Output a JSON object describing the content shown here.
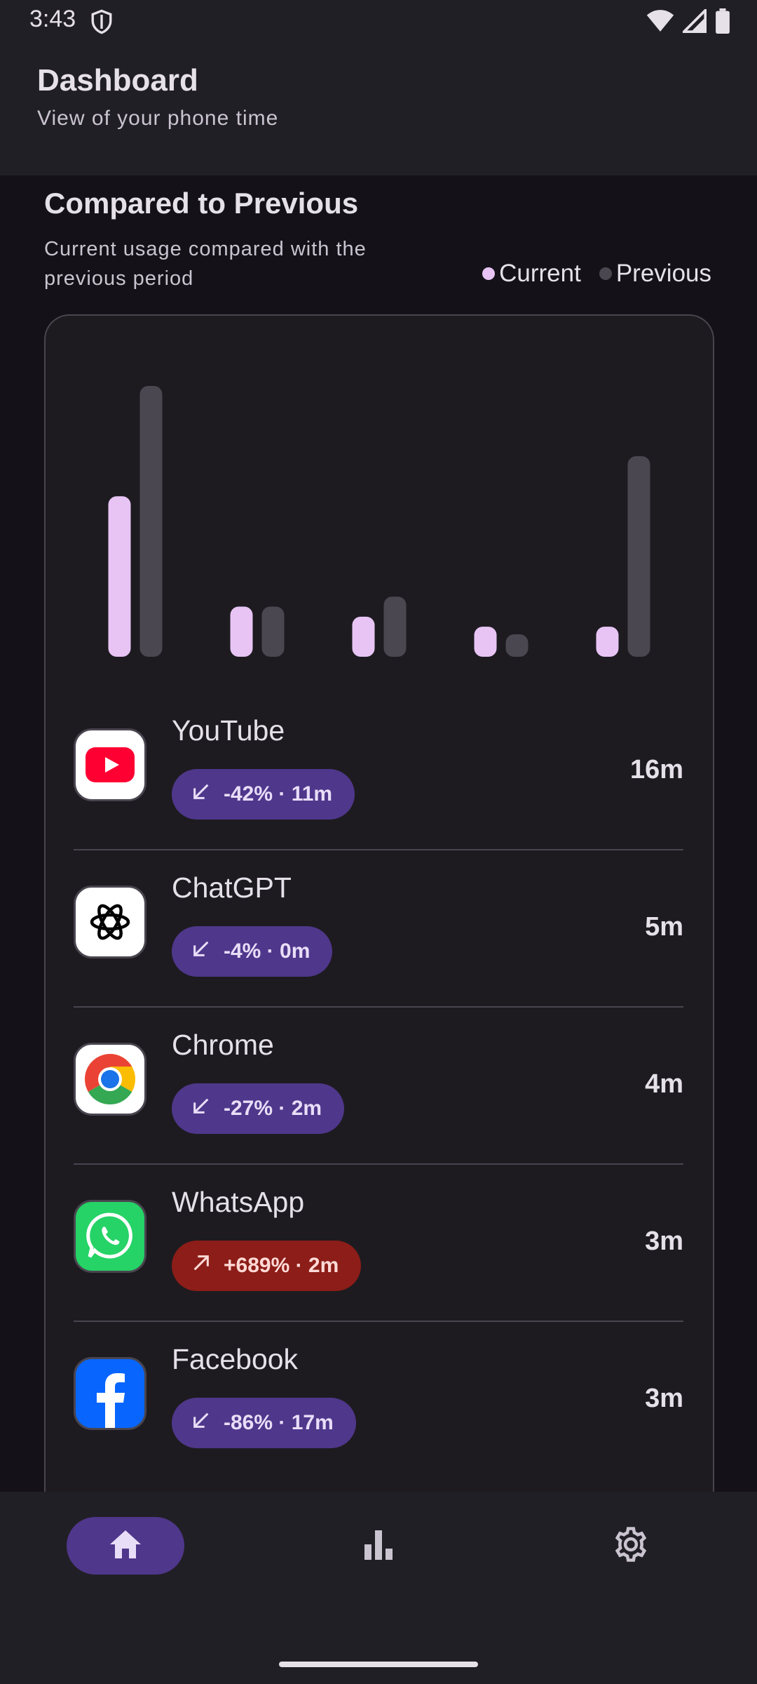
{
  "status_bar": {
    "time": "3:43"
  },
  "header": {
    "title": "Dashboard",
    "subtitle": "View of your phone time"
  },
  "section": {
    "title": "Compared to Previous",
    "description": "Current usage compared with the previous period"
  },
  "legend": {
    "current": "Current",
    "previous": "Previous"
  },
  "colors": {
    "current": "#e8c4f5",
    "previous": "#4a4750",
    "chip_down": "#4f378b",
    "chip_up": "#8c1d18"
  },
  "chart_data": {
    "type": "bar",
    "categories": [
      "YouTube",
      "ChatGPT",
      "Chrome",
      "WhatsApp",
      "Facebook"
    ],
    "series": [
      {
        "name": "Current",
        "values": [
          16,
          5,
          4,
          3,
          3
        ]
      },
      {
        "name": "Previous",
        "values": [
          27,
          5,
          6,
          0.4,
          20
        ]
      }
    ],
    "ylim": [
      0,
      27
    ]
  },
  "apps": [
    {
      "name": "YouTube",
      "time": "16m",
      "change": "-42% · 11m",
      "direction": "down",
      "icon": "youtube-icon"
    },
    {
      "name": "ChatGPT",
      "time": "5m",
      "change": "-4% · 0m",
      "direction": "down",
      "icon": "chatgpt-icon"
    },
    {
      "name": "Chrome",
      "time": "4m",
      "change": "-27% · 2m",
      "direction": "down",
      "icon": "chrome-icon"
    },
    {
      "name": "WhatsApp",
      "time": "3m",
      "change": "+689% · 2m",
      "direction": "up",
      "icon": "whatsapp-icon"
    },
    {
      "name": "Facebook",
      "time": "3m",
      "change": "-86% · 17m",
      "direction": "down",
      "icon": "facebook-icon"
    }
  ],
  "nav": {
    "items": [
      {
        "icon": "home-icon",
        "active": true
      },
      {
        "icon": "bar-chart-icon",
        "active": false
      },
      {
        "icon": "settings-icon",
        "active": false
      }
    ]
  }
}
